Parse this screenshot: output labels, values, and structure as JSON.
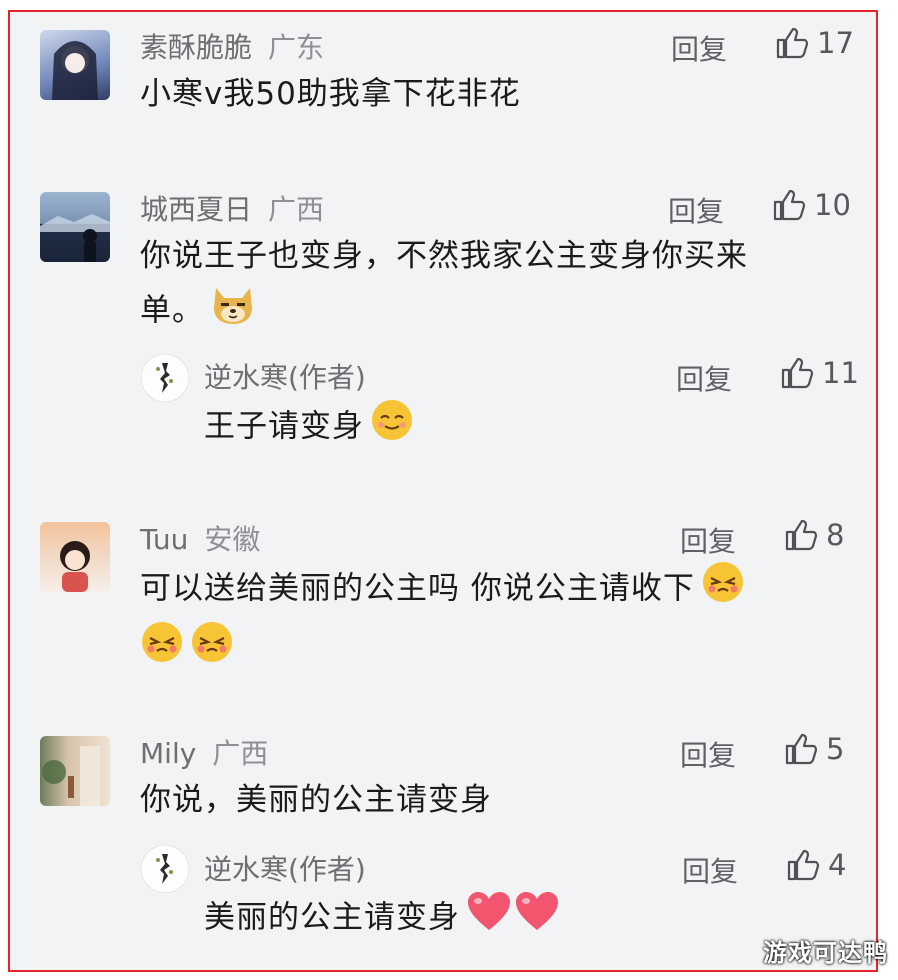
{
  "comments": [
    {
      "name": "素酥脆脆",
      "location": "广东",
      "text": "小寒v我50助我拿下花非花",
      "reply_label": "回复",
      "likes": "17"
    },
    {
      "name": "城西夏日",
      "location": "广西",
      "text_line1": "你说王子也变身，不然我家公主变身你买来",
      "text_line2": "单。",
      "reply_label": "回复",
      "likes": "10",
      "sub": {
        "name": "逆水寒(作者)",
        "text": "王子请变身",
        "reply_label": "回复",
        "likes": "11"
      }
    },
    {
      "name": "Tuu",
      "location": "安徽",
      "text": "可以送给美丽的公主吗 你说公主请收下",
      "reply_label": "回复",
      "likes": "8"
    },
    {
      "name": "Mily",
      "location": "广西",
      "text": "你说，美丽的公主请变身",
      "reply_label": "回复",
      "likes": "5",
      "sub": {
        "name": "逆水寒(作者)",
        "text": "美丽的公主请变身",
        "reply_label": "回复",
        "likes": "4"
      }
    }
  ],
  "icons": {
    "like": "thumbs-up-icon",
    "emoji_doge": "doge-emoji",
    "emoji_smile": "smile-emoji",
    "emoji_shy": "shy-emoji",
    "emoji_heart": "heart-emoji"
  },
  "colors": {
    "border": "#e2262a",
    "background": "#f2f3f5",
    "text": "#1b1b1d",
    "muted": "#6d6f73"
  },
  "watermark": "游戏可达鸭"
}
